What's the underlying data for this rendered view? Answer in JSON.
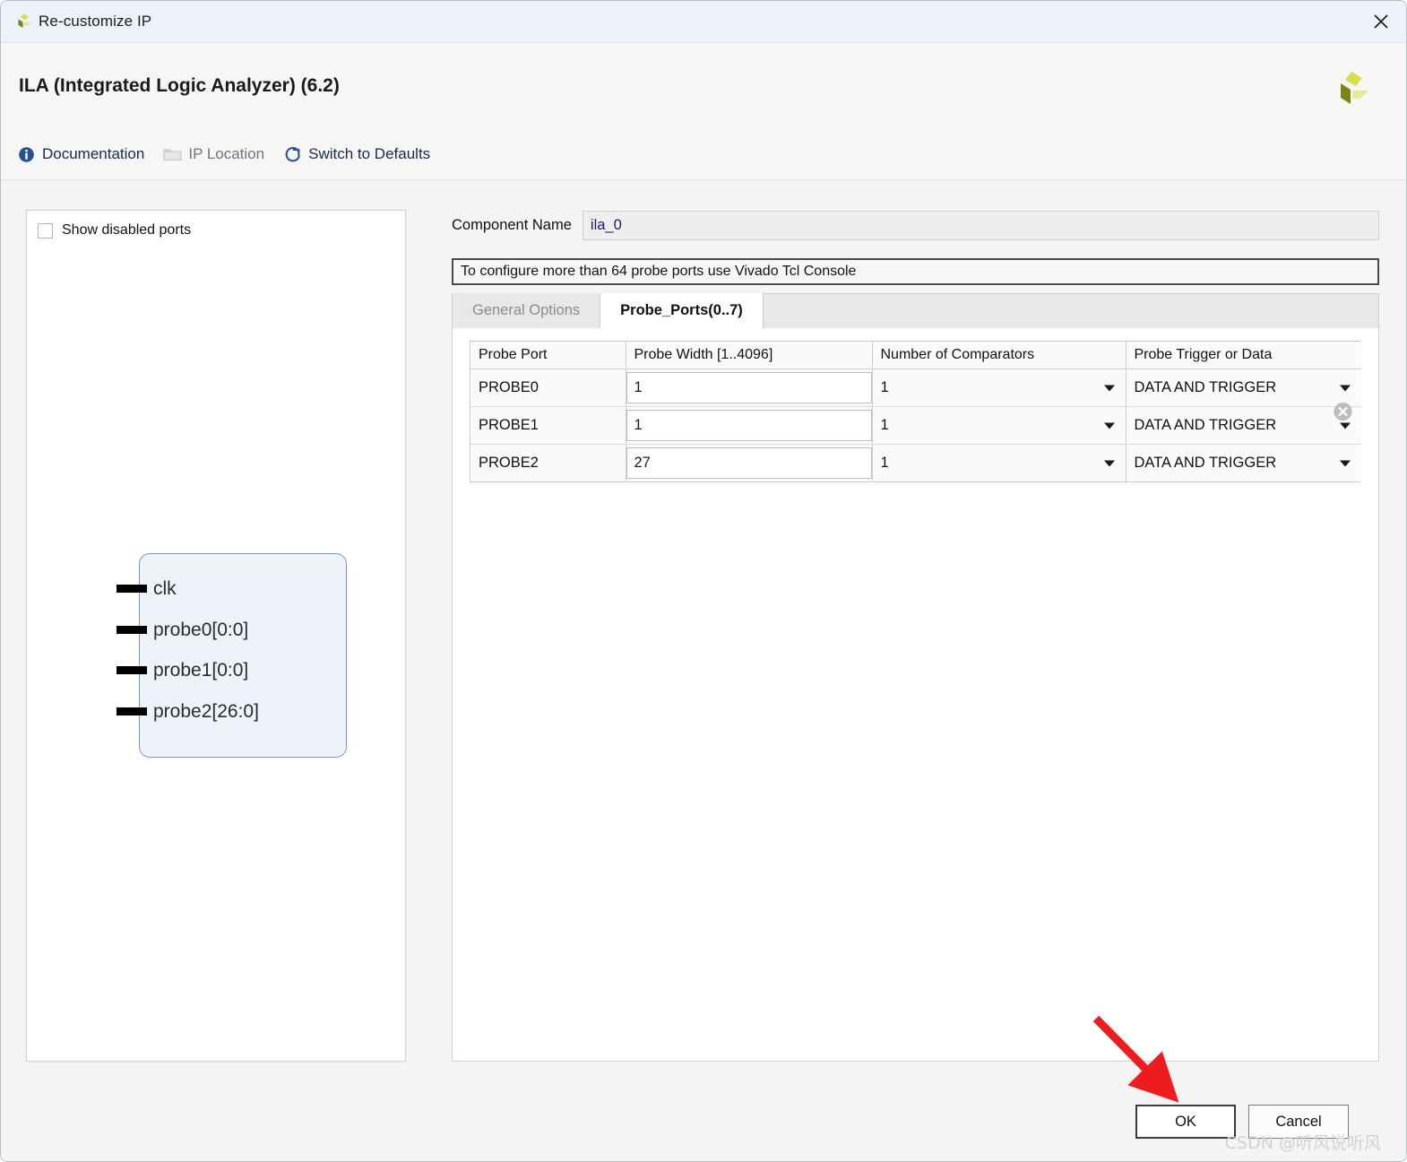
{
  "window": {
    "title": "Re-customize IP",
    "close_icon": "close-icon",
    "logo_icon": "xilinx-logo-icon"
  },
  "header": {
    "ip_title": "ILA (Integrated Logic Analyzer) (6.2)",
    "brand_logo_icon": "xilinx-logo-icon",
    "toolbar": [
      {
        "label": "Documentation",
        "icon": "info-icon",
        "enabled": true
      },
      {
        "label": "IP Location",
        "icon": "folder-icon",
        "enabled": false
      },
      {
        "label": "Switch to Defaults",
        "icon": "refresh-icon",
        "enabled": true
      }
    ]
  },
  "left_panel": {
    "show_disabled_ports": {
      "label": "Show disabled ports",
      "checked": false
    },
    "symbol": {
      "ports": [
        {
          "name": "clk"
        },
        {
          "name": "probe0[0:0]"
        },
        {
          "name": "probe1[0:0]"
        },
        {
          "name": "probe2[26:0]"
        }
      ]
    }
  },
  "right_panel": {
    "component_name": {
      "label": "Component Name",
      "value": "ila_0"
    },
    "info_message": "To configure more than 64 probe ports use Vivado Tcl Console",
    "tabs": [
      {
        "label": "General Options",
        "active": false
      },
      {
        "label": "Probe_Ports(0..7)",
        "active": true
      }
    ],
    "probe_table": {
      "columns": [
        "Probe Port",
        "Probe Width [1..4096]",
        "Number of Comparators",
        "Probe Trigger or Data"
      ],
      "rows": [
        {
          "port": "PROBE0",
          "width": "1",
          "comparators": "1",
          "trigger": "DATA AND TRIGGER"
        },
        {
          "port": "PROBE1",
          "width": "1",
          "comparators": "1",
          "trigger": "DATA AND TRIGGER"
        },
        {
          "port": "PROBE2",
          "width": "27",
          "comparators": "1",
          "trigger": "DATA AND TRIGGER"
        }
      ]
    }
  },
  "footer": {
    "ok_label": "OK",
    "cancel_label": "Cancel"
  },
  "annotation": {
    "arrow_color": "#ee1c1c",
    "arrow_target": "ok-button"
  },
  "watermark": "CSDN @听风说听风"
}
